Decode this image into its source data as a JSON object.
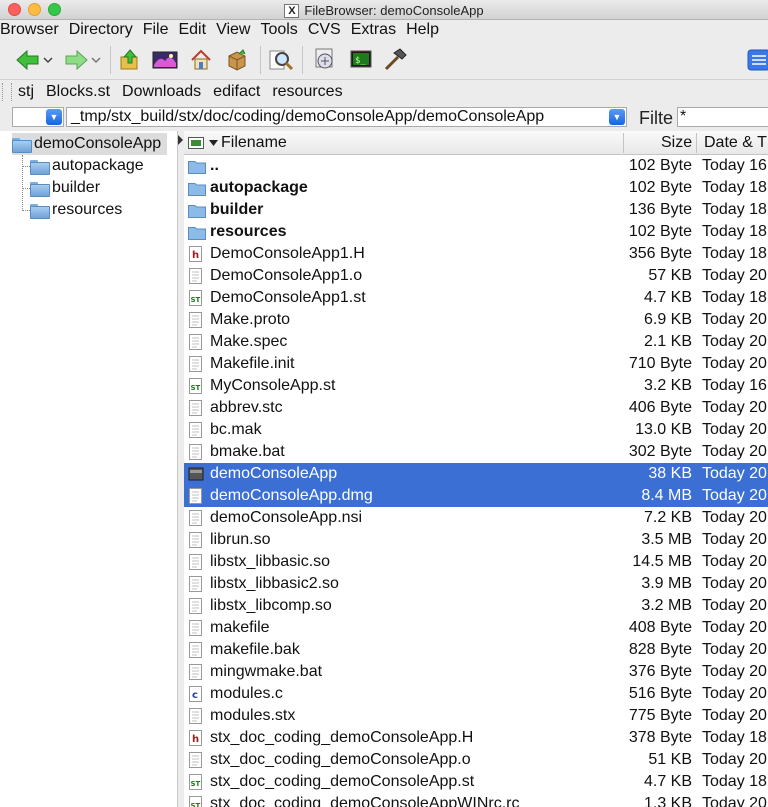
{
  "window": {
    "title": "FileBrowser: demoConsoleApp"
  },
  "menu": [
    "Browser",
    "Directory",
    "File",
    "Edit",
    "View",
    "Tools",
    "CVS",
    "Extras",
    "Help"
  ],
  "toolbar": {
    "icons": [
      "back-arrow-icon",
      "forward-arrow-icon",
      "parent-directory-icon",
      "image-viewer-icon",
      "home-icon",
      "package-icon",
      "search-icon",
      "changes-browser-icon",
      "terminal-icon",
      "build-hammer-icon"
    ]
  },
  "bookmarks": [
    "stj",
    "Blocks.st",
    "Downloads",
    "edifact",
    "resources"
  ],
  "pathbar": {
    "path": "_tmp/stx_build/stx/doc/coding/demoConsoleApp/demoConsoleApp",
    "filter_label": "Filte",
    "filter_value": "*"
  },
  "tree": {
    "root": "demoConsoleApp",
    "children": [
      "autopackage",
      "builder",
      "resources"
    ]
  },
  "list": {
    "columns": {
      "name": "Filename",
      "size": "Size",
      "date": "Date & T"
    },
    "rows": [
      {
        "name": "..",
        "size": "102 Byte",
        "date": "Today 16",
        "type": "folder",
        "bold": true
      },
      {
        "name": "autopackage",
        "size": "102 Byte",
        "date": "Today 18",
        "type": "folder",
        "bold": true
      },
      {
        "name": "builder",
        "size": "136 Byte",
        "date": "Today 18",
        "type": "folder",
        "bold": true
      },
      {
        "name": "resources",
        "size": "102 Byte",
        "date": "Today 18",
        "type": "folder",
        "bold": true
      },
      {
        "name": "DemoConsoleApp1.H",
        "size": "356 Byte",
        "date": "Today 18",
        "type": "h"
      },
      {
        "name": "DemoConsoleApp1.o",
        "size": "57 KB",
        "date": "Today 20",
        "type": "doc"
      },
      {
        "name": "DemoConsoleApp1.st",
        "size": "4.7 KB",
        "date": "Today 18",
        "type": "st"
      },
      {
        "name": "Make.proto",
        "size": "6.9 KB",
        "date": "Today 20",
        "type": "doc"
      },
      {
        "name": "Make.spec",
        "size": "2.1 KB",
        "date": "Today 20",
        "type": "doc"
      },
      {
        "name": "Makefile.init",
        "size": "710 Byte",
        "date": "Today 20",
        "type": "doc"
      },
      {
        "name": "MyConsoleApp.st",
        "size": "3.2 KB",
        "date": "Today 16",
        "type": "st"
      },
      {
        "name": "abbrev.stc",
        "size": "406 Byte",
        "date": "Today 20",
        "type": "doc"
      },
      {
        "name": "bc.mak",
        "size": "13.0 KB",
        "date": "Today 20",
        "type": "doc"
      },
      {
        "name": "bmake.bat",
        "size": "302 Byte",
        "date": "Today 20",
        "type": "doc"
      },
      {
        "name": "demoConsoleApp",
        "size": "38 KB",
        "date": "Today 20",
        "type": "exe",
        "selected": true
      },
      {
        "name": "demoConsoleApp.dmg",
        "size": "8.4 MB",
        "date": "Today 20",
        "type": "doc",
        "selected": true
      },
      {
        "name": "demoConsoleApp.nsi",
        "size": "7.2 KB",
        "date": "Today 20",
        "type": "doc"
      },
      {
        "name": "librun.so",
        "size": "3.5 MB",
        "date": "Today 20",
        "type": "doc"
      },
      {
        "name": "libstx_libbasic.so",
        "size": "14.5 MB",
        "date": "Today 20",
        "type": "doc"
      },
      {
        "name": "libstx_libbasic2.so",
        "size": "3.9 MB",
        "date": "Today 20",
        "type": "doc"
      },
      {
        "name": "libstx_libcomp.so",
        "size": "3.2 MB",
        "date": "Today 20",
        "type": "doc"
      },
      {
        "name": "makefile",
        "size": "408 Byte",
        "date": "Today 20",
        "type": "doc"
      },
      {
        "name": "makefile.bak",
        "size": "828 Byte",
        "date": "Today 20",
        "type": "doc"
      },
      {
        "name": "mingwmake.bat",
        "size": "376 Byte",
        "date": "Today 20",
        "type": "doc"
      },
      {
        "name": "modules.c",
        "size": "516 Byte",
        "date": "Today 20",
        "type": "c"
      },
      {
        "name": "modules.stx",
        "size": "775 Byte",
        "date": "Today 20",
        "type": "doc"
      },
      {
        "name": "stx_doc_coding_demoConsoleApp.H",
        "size": "378 Byte",
        "date": "Today 18",
        "type": "h"
      },
      {
        "name": "stx_doc_coding_demoConsoleApp.o",
        "size": "51 KB",
        "date": "Today 20",
        "type": "doc"
      },
      {
        "name": "stx_doc_coding_demoConsoleApp.st",
        "size": "4.7 KB",
        "date": "Today 18",
        "type": "st"
      },
      {
        "name": "stx_doc_coding_demoConsoleAppWINrc.rc",
        "size": "1.3 KB",
        "date": "Today 20",
        "type": "st"
      }
    ]
  }
}
